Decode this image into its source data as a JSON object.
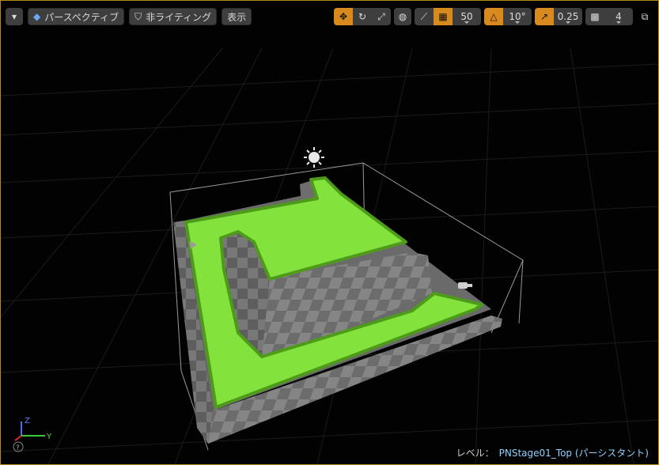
{
  "toolbar_left": {
    "menu_icon": "chevron-down-icon",
    "perspective_label": "パースペクティブ",
    "lighting_label": "非ライティング",
    "show_label": "表示"
  },
  "toolbar_right": {
    "grid_snap_value": "50",
    "rotation_snap_value": "10°",
    "scale_snap_value": "0.25",
    "camera_speed_value": "4",
    "accent_color": "#d98a1e"
  },
  "status": {
    "level_prefix": "レベル：",
    "level_name": "PNStage01_Top (パーシスタント)"
  },
  "axis_gizmo": {
    "z": "Z",
    "y": "Y",
    "help": "?"
  },
  "colors": {
    "floor_green": "#84e23c",
    "floor_edge": "#4e9a1a",
    "wall_gray": "#7a7a7a",
    "viewport_border": "#b88a1e"
  }
}
